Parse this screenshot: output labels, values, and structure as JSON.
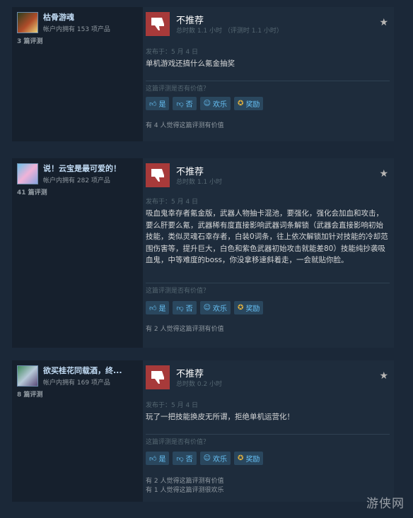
{
  "reviews": [
    {
      "user": "枯骨游魂",
      "owned": "帐户内拥有 153 项产品",
      "review_count": "3 篇评测",
      "verdict": "不推荐",
      "hours": "总时数 1.1 小时   （评测时 1.1 小时）",
      "posted": "发布于：5 月 4 日",
      "body": "单机游戏还搞什么氪金抽奖",
      "helpful_q": "这篇评测是否有价值？",
      "found": [
        "有 4 人觉得这篇评测有价值"
      ]
    },
    {
      "user": "说！云宝是最可爱的！",
      "owned": "帐户内拥有 282 项产品",
      "review_count": "41 篇评测",
      "verdict": "不推荐",
      "hours": "总时数 1.1 小时",
      "posted": "发布于：5 月 4 日",
      "body": "吸血鬼幸存者氪金版，武器人物抽卡混池，要强化，强化会加血和攻击，要么肝要么氪，武器稀有度直接影响武器词条解锁（武器会直接影响初始技能，类似灵魂石幸存者，白装0词条，往上依次解锁加针对技能的冷却范围伤害等，提升巨大，白色和紫色武器初始攻击就能差80）技能纯抄袭吸血鬼，中等难度的boss，你没拿移速斜着走，一会就贴你脸。",
      "helpful_q": "这篇评测是否有价值？",
      "found": [
        "有 2 人觉得这篇评测有价值"
      ]
    },
    {
      "user": "欲买桂花同载酒，终...",
      "owned": "帐户内拥有 169 项产品",
      "review_count": "8 篇评测",
      "verdict": "不推荐",
      "hours": "总时数 0.2 小时",
      "posted": "发布于：5 月 4 日",
      "body": "玩了一把技能换皮无所谓，拒绝单机运营化！",
      "helpful_q": "这篇评测是否有价值？",
      "found": [
        "有 2 人觉得这篇评测有价值",
        "有 1 人觉得这篇评测很欢乐"
      ]
    }
  ],
  "buttons": {
    "yes": "是",
    "no": "否",
    "funny": "欢乐",
    "award": "奖励"
  },
  "icons": {
    "thumb": "thumbs-down-icon",
    "star": "star-icon",
    "yes": "thumbs-up-icon",
    "no": "thumbs-down-icon",
    "funny": "smiley-icon",
    "award": "award-icon"
  },
  "colors": {
    "thumb_bg": "#a73a3a",
    "link": "#67c1f5",
    "name": "#c1dbf4"
  },
  "watermark": "游侠网"
}
